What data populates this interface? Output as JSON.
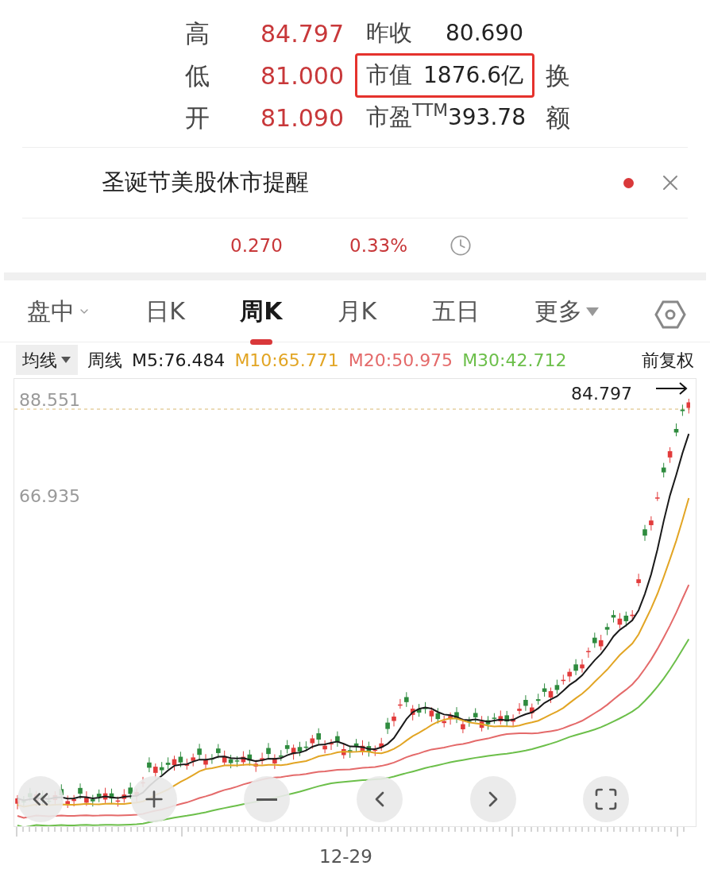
{
  "stats": [
    {
      "label": "高",
      "value": "84.797",
      "label2": "昨收",
      "value2": "80.690",
      "highlighted": false
    },
    {
      "label": "低",
      "value": "81.000",
      "label2": "市值",
      "value2": "1876.6亿",
      "highlighted": true,
      "label3": "换"
    },
    {
      "label": "开",
      "value": "81.090",
      "label2": "市盈$^{TTM}$",
      "value2": "393.78",
      "highlighted": false,
      "label3": "额"
    }
  ],
  "notice": {
    "text": "圣诞节美股休市提醒",
    "unread": true
  },
  "change": {
    "amount": "0.270",
    "percent": "0.33%"
  },
  "tabs": [
    {
      "label": "盘中",
      "selected": false,
      "kind": "dropdown"
    },
    {
      "label": "日K",
      "selected": false,
      "kind": "plain"
    },
    {
      "label": "周K",
      "selected": true,
      "kind": "plain"
    },
    {
      "label": "月K",
      "selected": false,
      "kind": "plain"
    },
    {
      "label": "五日",
      "selected": false,
      "kind": "plain"
    },
    {
      "label": "更多",
      "selected": false,
      "kind": "menu"
    }
  ],
  "indicator_bar": {
    "indicator": "均线",
    "period": "周线",
    "averages": [
      {
        "text": "M5:76.484",
        "color": "#1a1a1a"
      },
      {
        "text": "M10:65.771",
        "color": "#e2a524"
      },
      {
        "text": "M20:50.975",
        "color": "#e46a6a"
      },
      {
        "text": "M30:42.712",
        "color": "#6cbf4a"
      }
    ],
    "adjustment": "前复权"
  },
  "chart": {
    "y_labels": [
      "88.551",
      "66.935"
    ],
    "last_price": "84.797",
    "x_labels": [
      "12-29"
    ]
  }
}
